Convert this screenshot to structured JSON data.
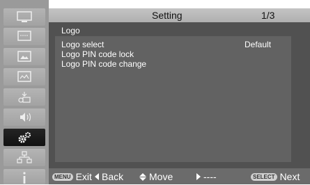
{
  "header": {
    "title": "Setting",
    "page": "1/3"
  },
  "sidebar": {
    "items": [
      {
        "icon": "display-icon",
        "selected": false
      },
      {
        "icon": "pc-adjust-icon",
        "selected": false
      },
      {
        "icon": "image-select-icon",
        "selected": false
      },
      {
        "icon": "image-adjust-icon",
        "selected": false
      },
      {
        "icon": "screen-icon",
        "selected": false
      },
      {
        "icon": "sound-icon",
        "selected": false
      },
      {
        "icon": "setting-gear-icon",
        "selected": true
      },
      {
        "icon": "network-icon",
        "selected": false
      },
      {
        "icon": "info-icon",
        "selected": false
      }
    ]
  },
  "panel": {
    "title": "Logo",
    "items": [
      {
        "label": "Logo select",
        "value": "Default"
      },
      {
        "label": "Logo PIN code lock"
      },
      {
        "label": "Logo PIN  code change"
      }
    ]
  },
  "footer": {
    "exit": {
      "key": "MENU",
      "label": "Exit"
    },
    "back": {
      "label": "Back"
    },
    "move": {
      "label": "Move"
    },
    "next_right": {
      "label": "----"
    },
    "next": {
      "key": "SELECT",
      "label": "Next"
    }
  },
  "colors": {
    "sidebar_selected": "#1a1a1a",
    "panel": "#515151",
    "text": "#ffffff"
  }
}
